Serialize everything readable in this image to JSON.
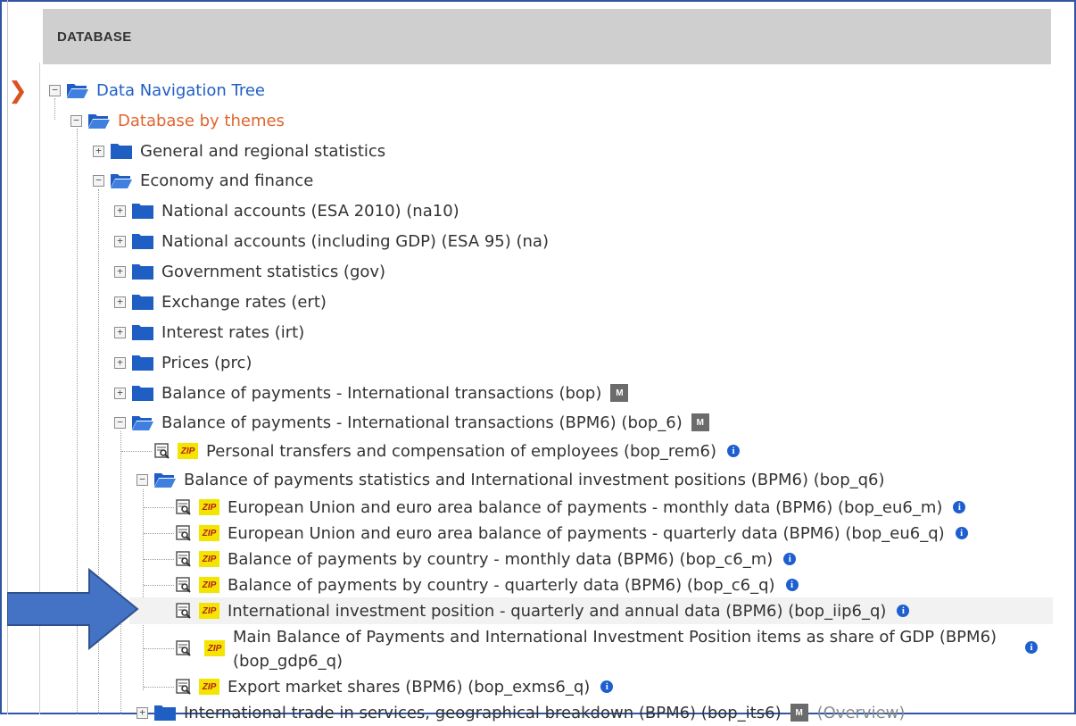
{
  "header": {
    "title": "DATABASE"
  },
  "tree": {
    "root": "Data Navigation Tree",
    "themes": "Database by themes",
    "general": "General and regional statistics",
    "economy": "Economy and finance",
    "economy_children": [
      "National accounts (ESA 2010) (na10)",
      "National accounts (including GDP) (ESA 95) (na)",
      "Government statistics (gov)",
      "Exchange rates (ert)",
      "Interest rates (irt)",
      "Prices (prc)",
      "Balance of payments - International transactions (bop)"
    ],
    "bpm6_folder": "Balance of payments - International transactions (BPM6) (bop_6)",
    "personal_transfers": "Personal transfers and compensation of employees (bop_rem6)",
    "bop_stats_folder": "Balance of payments statistics and International investment positions (BPM6) (bop_q6)",
    "datasets": [
      "European Union and euro area balance of payments - monthly data (BPM6) (bop_eu6_m)",
      "European Union and euro area balance of payments - quarterly data (BPM6) (bop_eu6_q)",
      "Balance of payments by country - monthly data (BPM6) (bop_c6_m)",
      "Balance of payments by country - quarterly data (BPM6) (bop_c6_q)",
      "International investment position - quarterly and annual data (BPM6) (bop_iip6_q)"
    ],
    "main_bop_line1": "Main Balance of Payments and International Investment Position items as share of GDP (BPM6)",
    "main_bop_line2": "(bop_gdp6_q)",
    "export_shares": "Export market shares (BPM6) (bop_exms6_q)",
    "partial_next": "International trade in services, geographical breakdown (BPM6) (bop_its6)",
    "partial_next_note": "(Overview)"
  },
  "icons": {
    "zip_text": "ZIP",
    "info_text": "i",
    "meta_text": "M",
    "toggle_expanded": "−",
    "toggle_collapsed": "+"
  },
  "colors": {
    "folder": "#1f5fc4",
    "root_text": "#1f5fc4",
    "themes_text": "#e0652d",
    "arrow": "#4472c4",
    "frame": "#2f55a4"
  }
}
